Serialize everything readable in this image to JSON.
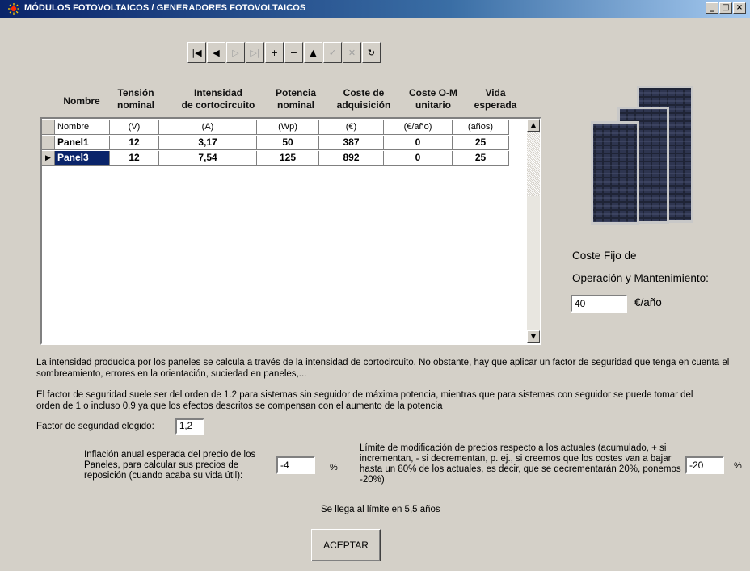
{
  "window": {
    "title": "MÓDULOS FOTOVOLTAICOS / GENERADORES FOTOVOLTAICOS",
    "minimize": "_",
    "maximize": "□",
    "close": "×"
  },
  "navigator": [
    {
      "name": "first-record-icon",
      "glyph": "|◀",
      "enabled": true
    },
    {
      "name": "prior-record-icon",
      "glyph": "◀",
      "enabled": true
    },
    {
      "name": "next-record-icon",
      "glyph": "▷",
      "enabled": false
    },
    {
      "name": "last-record-icon",
      "glyph": "▷|",
      "enabled": false
    },
    {
      "name": "insert-record-icon",
      "glyph": "+",
      "enabled": true
    },
    {
      "name": "delete-record-icon",
      "glyph": "−",
      "enabled": true
    },
    {
      "name": "edit-record-icon",
      "glyph": "▲",
      "enabled": true
    },
    {
      "name": "post-record-icon",
      "glyph": "✓",
      "enabled": false
    },
    {
      "name": "cancel-record-icon",
      "glyph": "✕",
      "enabled": false
    },
    {
      "name": "refresh-record-icon",
      "glyph": "↻",
      "enabled": true
    }
  ],
  "columns": {
    "nombre": "Nombre",
    "tension": [
      "Tensión",
      "nominal"
    ],
    "intensidad": [
      "Intensidad",
      "de cortocircuito"
    ],
    "potencia": [
      "Potencia",
      "nominal"
    ],
    "coste": [
      "Coste de",
      "adquisición"
    ],
    "costeom": [
      "Coste O-M",
      "unitario"
    ],
    "vida": [
      "Vida",
      "esperada"
    ]
  },
  "units": [
    "Nombre",
    "(V)",
    "(A)",
    "(Wp)",
    "(€)",
    "(€/año)",
    "(años)"
  ],
  "rows": [
    [
      "Panel1",
      "12",
      "3,17",
      "50",
      "387",
      "0",
      "25"
    ],
    [
      "Panel3",
      "12",
      "7,54",
      "125",
      "892",
      "0",
      "25"
    ]
  ],
  "fixed_cost": {
    "label1": "Coste Fijo de",
    "label2": "Operación y Mantenimiento:",
    "value": "40",
    "unit": "€/año"
  },
  "info1": "La intensidad producida por los paneles se calcula  a través de la intensidad de cortocircuito. No obstante, hay que aplicar un factor de seguridad que tenga en cuenta el sombreamiento, errores en la orientación, suciedad en paneles,...",
  "info2": "El factor de seguridad suele ser del orden de 1.2 para sistemas sin seguidor de máxima potencia, mientras que para sistemas con seguidor se puede tomar del orden de 1 o incluso 0,9 ya que los efectos descritos se compensan con el aumento de la potencia",
  "safety": {
    "label": "Factor de seguridad elegido:",
    "value": "1,2"
  },
  "inflation": {
    "label": "Inflación anual esperada del precio de los Paneles, para calcular sus precios de reposición (cuando acaba su vida útil):",
    "value": "-4",
    "unit": "%"
  },
  "limit": {
    "label": "Límite de modificación de precios respecto a los actuales (acumulado, + si incrementan, - si decrementan, p. ej., si creemos que los costes van a bajar hasta un 80% de los actuales, es decir, que se decrementarán 20%, ponemos -20%)",
    "value": "-20",
    "unit": "%"
  },
  "limit_note": "Se llega al límite en 5,5 años",
  "accept": "ACEPTAR"
}
